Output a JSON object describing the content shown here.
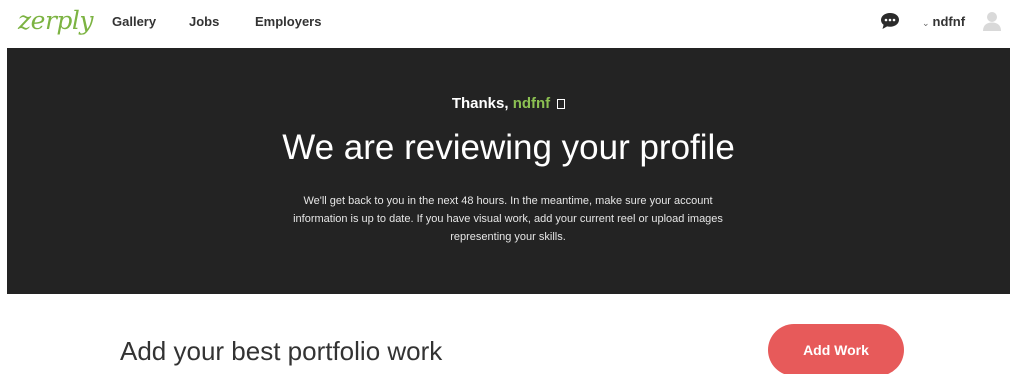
{
  "brand": {
    "logo_text": "zerply",
    "logo_color": "#7cb342"
  },
  "nav": {
    "gallery": "Gallery",
    "jobs": "Jobs",
    "employers": "Employers"
  },
  "user": {
    "username": "ndfnf",
    "chevron": "⌄",
    "chat_icon": "speech-bubble-icon",
    "avatar_icon": "user-silhouette-icon"
  },
  "hero": {
    "thanks_prefix": "Thanks, ",
    "username": "ndfnf",
    "title": "We are reviewing your profile",
    "description": "We'll get back to you in the next 48 hours. In the meantime, make sure your account information is up to date. If you have visual work, add your current reel or upload images representing your skills.",
    "background": "#232323"
  },
  "portfolio": {
    "title": "Add your best portfolio work",
    "add_button": "Add Work",
    "button_color": "#e75a5a"
  }
}
